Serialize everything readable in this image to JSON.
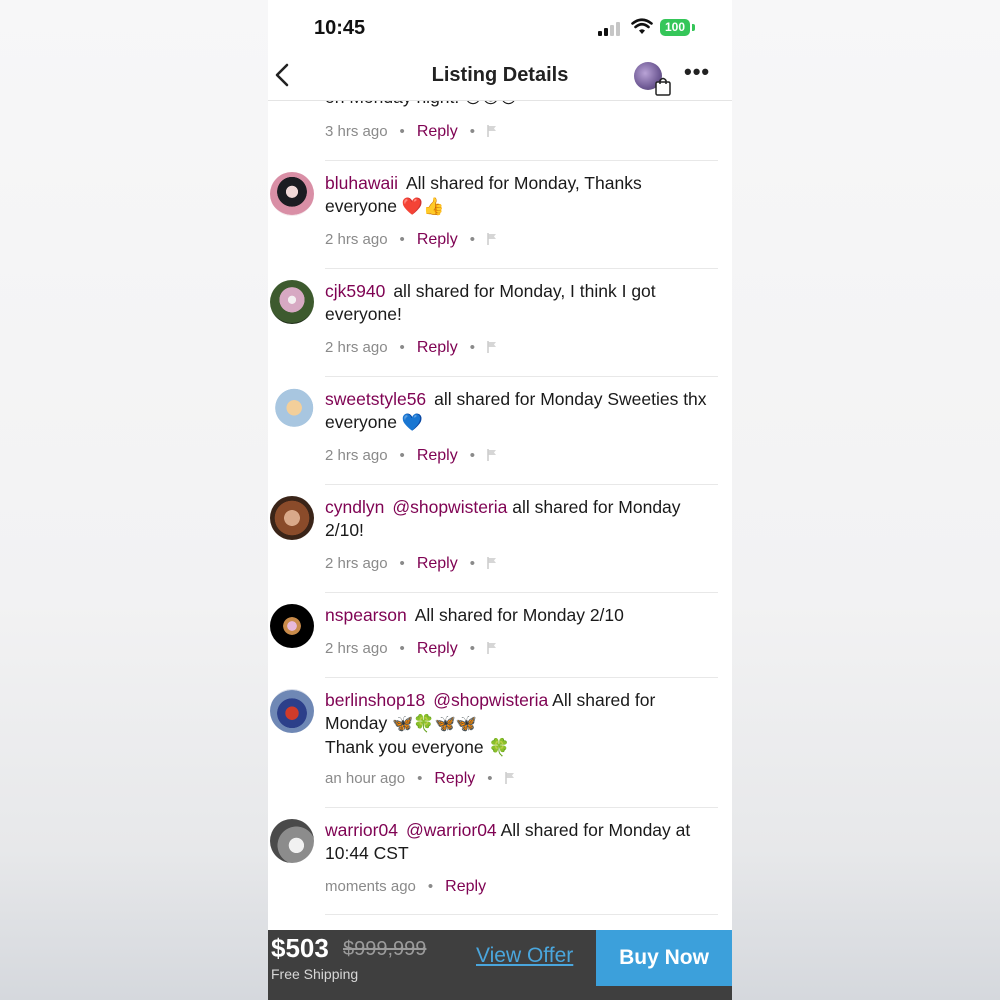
{
  "status_bar": {
    "time": "10:45",
    "battery": "100"
  },
  "nav": {
    "title": "Listing Details"
  },
  "partial_comment": {
    "text_tail": "on Monday night! ",
    "emojis": "🐱😍🐱",
    "time": "3 hrs ago",
    "reply": "Reply"
  },
  "comments": [
    {
      "username": "bluhawaii",
      "mention": "",
      "text": "All shared for Monday, Thanks everyone ",
      "emoji": "❤️👍",
      "time": "2 hrs ago",
      "reply": "Reply"
    },
    {
      "username": "cjk5940",
      "mention": "",
      "text": "all shared for Monday, I think I got everyone!",
      "emoji": "",
      "time": "2 hrs ago",
      "reply": "Reply"
    },
    {
      "username": "sweetstyle56",
      "mention": "",
      "text": "all shared for Monday Sweeties thx everyone ",
      "emoji": "💙",
      "time": "2 hrs ago",
      "reply": "Reply"
    },
    {
      "username": "cyndlyn",
      "mention": "@shopwisteria",
      "text": " all shared for Monday 2/10!",
      "emoji": "",
      "time": "2 hrs ago",
      "reply": "Reply"
    },
    {
      "username": "nspearson",
      "mention": "",
      "text": "All shared for Monday 2/10",
      "emoji": "",
      "time": "2 hrs ago",
      "reply": "Reply"
    },
    {
      "username": "berlinshop18",
      "mention": "@shopwisteria",
      "text": " All shared for Monday ",
      "emoji": "🦋🍀🦋🦋",
      "text2": "Thank you everyone ",
      "emoji2": "🍀",
      "time": "an hour ago",
      "reply": "Reply"
    },
    {
      "username": "warrior04",
      "mention": "@warrior04",
      "text": " All shared for Monday at 10:44 CST",
      "emoji": "",
      "time": "moments ago",
      "reply": "Reply"
    }
  ],
  "bottom_bar": {
    "price": "$503",
    "original_price": "$999,999",
    "shipping": "Free Shipping",
    "view_offer": "View Offer",
    "buy_now": "Buy Now"
  },
  "colors": {
    "username": "#7f0353",
    "accent_blue": "#3ca0db",
    "bottom_bar": "#3f3f3f"
  }
}
